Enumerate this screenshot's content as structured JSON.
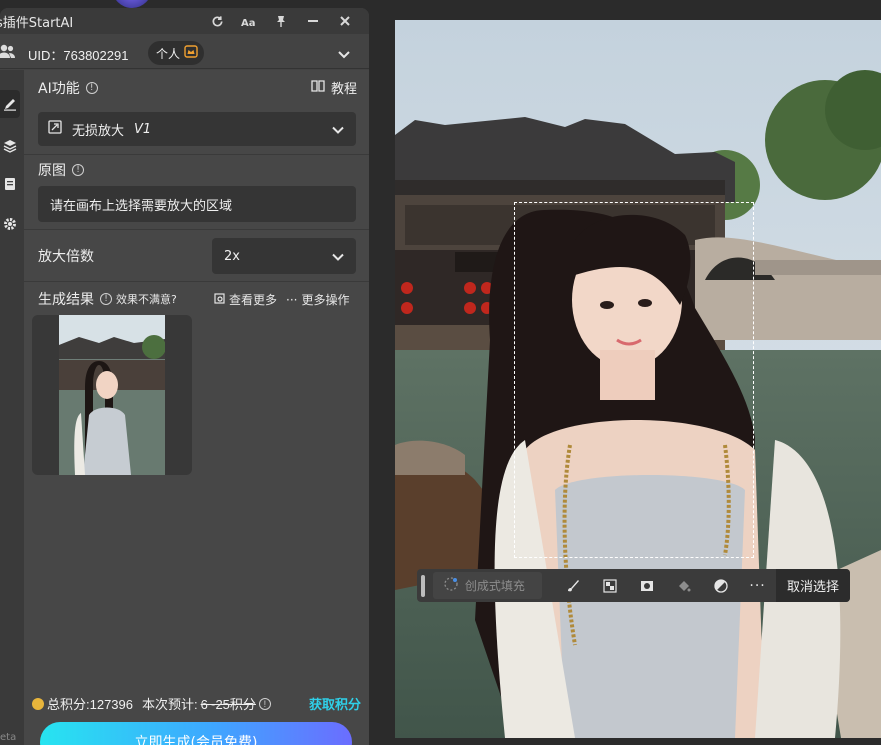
{
  "plugin": {
    "title": "s插件StartAI",
    "uid_text": "UID：763802291",
    "account_badge": "个人",
    "ai_function_label": "AI功能",
    "tutorial_label": "教程",
    "function_value": "无损放大",
    "function_version": "V1",
    "source_label": "原图",
    "source_placeholder": "请在画布上选择需要放大的区域",
    "scale_label": "放大倍数",
    "scale_value": "2x",
    "result_label": "生成结果",
    "unsatisfied_label": "效果不满意?",
    "view_more_label": "查看更多",
    "more_actions_label": "更多操作",
    "total_points_label": "总积分:127396",
    "estimate_label": "本次预计:",
    "estimate_value": "6~25积分",
    "get_points_label": "获取积分",
    "generate_button": "立即生成(会员免费)",
    "footer_text": "eta"
  },
  "canvas_toolbar": {
    "generative_fill_label": "创成式填充",
    "cancel_selection_label": "取消选择"
  },
  "colors": {
    "accent": "#2fd0e8",
    "panel_bg": "#434343",
    "canvas_bg": "#2b2b2b"
  }
}
